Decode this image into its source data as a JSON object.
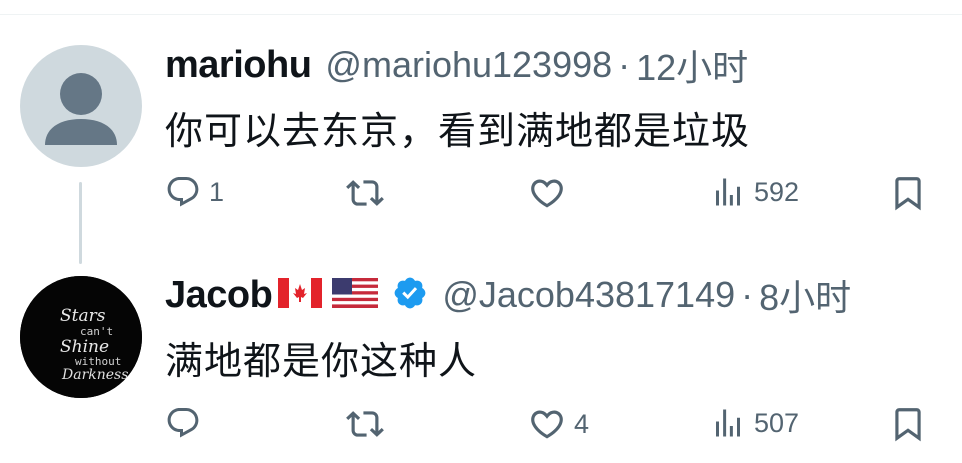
{
  "posts": [
    {
      "display_name": "mariohu",
      "handle": "@mariohu123998",
      "separator": "·",
      "time": "12小时",
      "text": "你可以去东京，看到满地都是垃圾",
      "reply_count": "1",
      "retweet_count": "",
      "like_count": "",
      "view_count": "592"
    },
    {
      "display_name": "Jacob",
      "handle": "@Jacob43817149",
      "separator": "·",
      "time": "8小时",
      "text": "满地都是你这种人",
      "reply_count": "",
      "retweet_count": "",
      "like_count": "4",
      "view_count": "507",
      "avatar_text": [
        "Stars",
        "can't",
        "Shine",
        "without",
        "Darkness"
      ]
    }
  ],
  "colors": {
    "muted": "#536471",
    "verified": "#1d9bf0",
    "thread_line": "#cfd9de"
  },
  "icons": [
    "reply-icon",
    "retweet-icon",
    "like-icon",
    "views-icon",
    "bookmark-icon",
    "verified-badge-icon"
  ]
}
